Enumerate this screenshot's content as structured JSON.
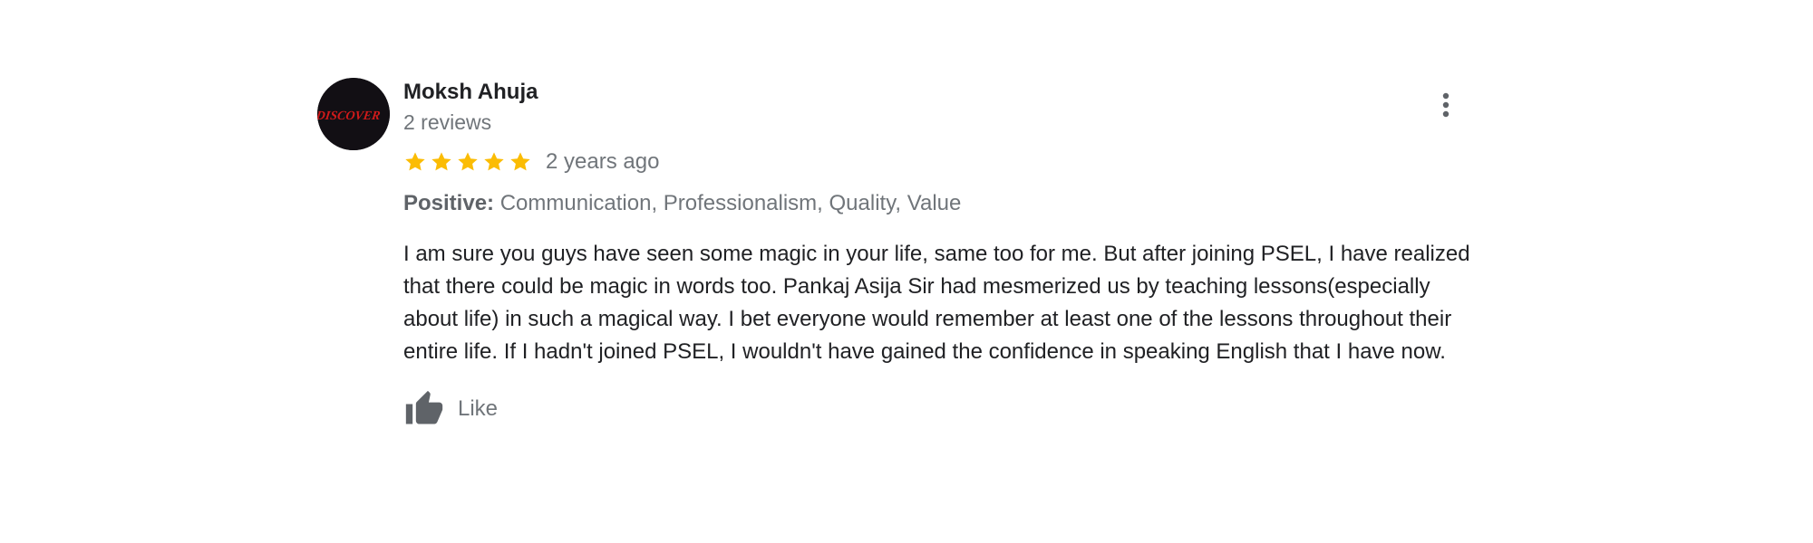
{
  "review": {
    "author": {
      "name": "Moksh Ahuja",
      "reviews_count": "2 reviews",
      "avatar_text": "DISCOVER"
    },
    "rating": 5,
    "rating_max": 5,
    "time": "2 years ago",
    "positive": {
      "label": "Positive:",
      "items": "Communication, Professionalism, Quality, Value"
    },
    "text": "I am sure you guys have seen some magic in your life, same too for me. But after joining PSEL, I have realized that there could be magic in words too. Pankaj Asija Sir had mesmerized us by teaching lessons(especially about life) in such a magical way. I bet everyone would remember at least one of the lessons throughout their entire life. If I hadn't joined PSEL, I wouldn't have gained the confidence in speaking English that I have now.",
    "like_label": "Like"
  },
  "icons": {
    "star": "star-icon",
    "like": "thumbs-up-icon",
    "more": "more-vert-icon"
  },
  "colors": {
    "star": "#fbbc04",
    "secondary_text": "#70757a",
    "primary_text": "#202124",
    "avatar_text": "#d01a1a"
  }
}
